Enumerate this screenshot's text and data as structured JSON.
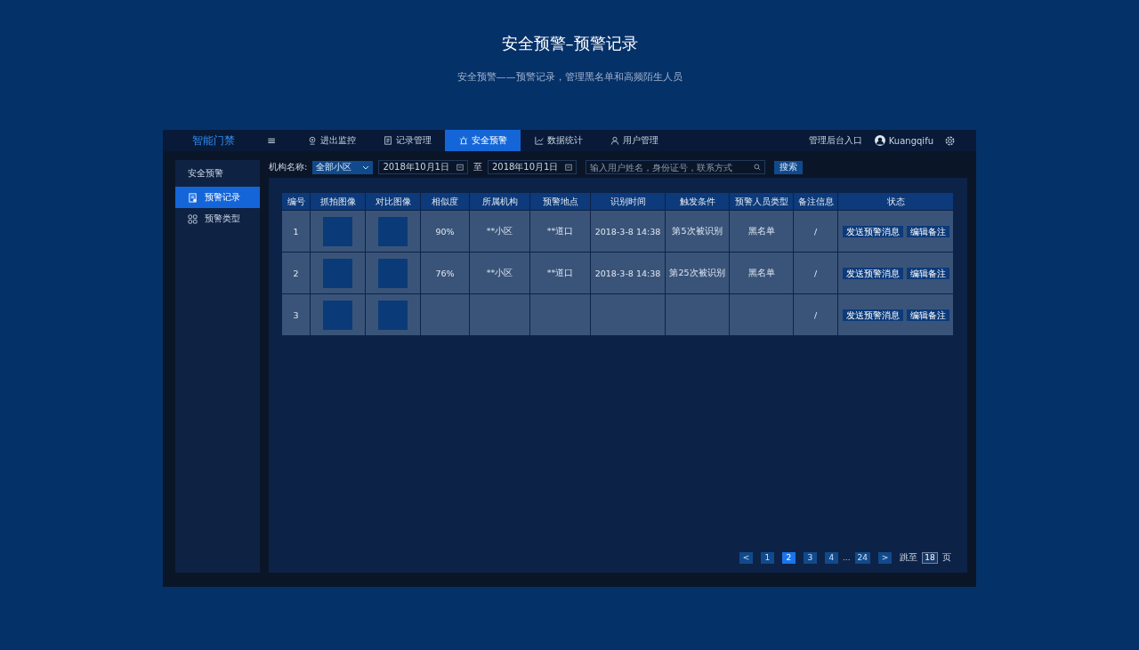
{
  "page": {
    "title": "安全预警–预警记录",
    "subtitle": "安全预警——预警记录，管理黑名单和高频陌生人员"
  },
  "app": {
    "logo": "智能门禁",
    "menu_icon": "≡",
    "nav_tabs": [
      {
        "label": "进出监控",
        "selected": false
      },
      {
        "label": "记录管理",
        "selected": false
      },
      {
        "label": "安全预警",
        "selected": true
      },
      {
        "label": "数据统计",
        "selected": false
      },
      {
        "label": "用户管理",
        "selected": false
      }
    ],
    "admin_link": "管理后台入口",
    "user": "Kuangqifu",
    "sidebar": {
      "header": "安全预警",
      "items": [
        {
          "label": "预警记录",
          "selected": true
        },
        {
          "label": "预警类型",
          "selected": false
        }
      ]
    },
    "filter": {
      "org_label": "机构名称:",
      "org_value": "全部小区",
      "date_from": "2018年10月1日",
      "to": "至",
      "date_to": "2018年10月1日",
      "search_placeholder": "输入用户姓名，身份证号，联系方式",
      "search_button": "搜索"
    },
    "table": {
      "columns": [
        "编号",
        "抓拍图像",
        "对比图像",
        "相似度",
        "所属机构",
        "预警地点",
        "识别时间",
        "触发条件",
        "预警人员类型",
        "备注信息",
        "状态"
      ],
      "rows": [
        {
          "cells": [
            "1",
            "",
            "",
            "90%",
            "**小区",
            "**道口",
            "2018-3-8 14:38",
            "第5次被识别",
            "黑名单",
            "/"
          ],
          "actions": [
            "发送预警消息",
            "编辑备注"
          ]
        },
        {
          "cells": [
            "2",
            "",
            "",
            "76%",
            "**小区",
            "**道口",
            "2018-3-8 14:38",
            "第25次被识别",
            "黑名单",
            "/"
          ],
          "actions": [
            "发送预警消息",
            "编辑备注"
          ]
        },
        {
          "cells": [
            "3",
            "",
            "",
            "",
            "",
            "",
            "",
            "",
            "",
            "/"
          ],
          "actions": [
            "发送预警消息",
            "编辑备注"
          ]
        }
      ]
    },
    "pagination": {
      "prev": "<",
      "pages": [
        {
          "label": "1",
          "selected": false
        },
        {
          "label": "2",
          "selected": true
        },
        {
          "label": "3",
          "selected": false
        },
        {
          "label": "4",
          "selected": false
        }
      ],
      "ellipsis": "...",
      "last": "24",
      "next": ">",
      "jump_label": "跳至",
      "jump_value": "18",
      "jump_unit": "页"
    }
  }
}
